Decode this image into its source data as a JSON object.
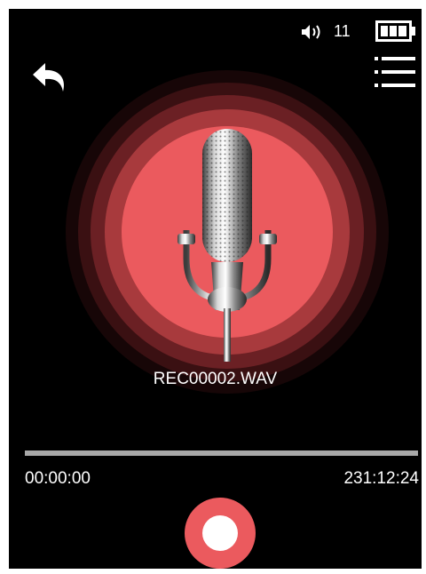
{
  "status_bar": {
    "volume_icon": "speaker-icon",
    "volume_value": "11",
    "battery_icon": "battery-icon",
    "battery_level": 1.0
  },
  "toolbar": {
    "back_icon": "back-arrow-icon",
    "menu_icon": "list-menu-icon"
  },
  "recorder": {
    "mic_icon": "microphone-icon",
    "file_name": "REC00002.WAV",
    "progress": 0.0,
    "elapsed": "00:00:00",
    "total": "231:12:24",
    "record_icon": "record-icon"
  },
  "colors": {
    "accent": "#eb5a5e",
    "background": "#000000",
    "text": "#ffffff",
    "track": "#a8a8a8"
  }
}
